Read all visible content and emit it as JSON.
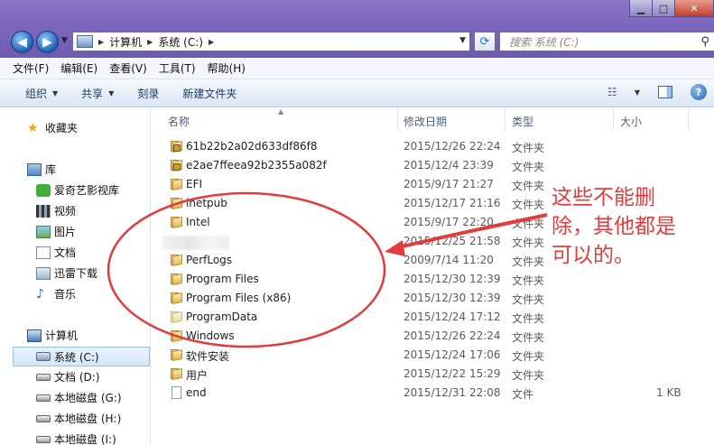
{
  "window": {
    "controls": {
      "minimize": "▁",
      "maximize": "□",
      "close": "✕"
    }
  },
  "nav": {
    "back": "◀",
    "forward": "▶"
  },
  "address": {
    "crumbs": [
      "计算机",
      "系统 (C:)"
    ],
    "search_placeholder": "搜索 系统 (C:)"
  },
  "menubar": [
    "文件(F)",
    "编辑(E)",
    "查看(V)",
    "工具(T)",
    "帮助(H)"
  ],
  "toolbar": {
    "organize": "组织",
    "share": "共享",
    "burn": "刻录",
    "new_folder": "新建文件夹"
  },
  "sidebar": {
    "favorites": "收藏夹",
    "libraries": "库",
    "library_items": [
      "爱奇艺影视库",
      "视频",
      "图片",
      "文档",
      "迅雷下载",
      "音乐"
    ],
    "computer": "计算机",
    "drives": [
      "系统 (C:)",
      "文档 (D:)",
      "本地磁盘 (G:)",
      "本地磁盘 (H:)",
      "本地磁盘 (I:)"
    ]
  },
  "columns": {
    "name": "名称",
    "date": "修改日期",
    "type": "类型",
    "size": "大小"
  },
  "files": [
    {
      "name": "61b22b2a02d633df86f8",
      "date": "2015/12/26 22:24",
      "type": "文件夹",
      "size": "",
      "icon": "folder-lock"
    },
    {
      "name": "e2ae7ffeea92b2355a082f",
      "date": "2015/12/4 23:39",
      "type": "文件夹",
      "size": "",
      "icon": "folder-lock"
    },
    {
      "name": "EFI",
      "date": "2015/9/17 21:27",
      "type": "文件夹",
      "size": "",
      "icon": "folder"
    },
    {
      "name": "inetpub",
      "date": "2015/12/17 21:16",
      "type": "文件夹",
      "size": "",
      "icon": "folder"
    },
    {
      "name": "Intel",
      "date": "2015/9/17 22:20",
      "type": "文件夹",
      "size": "",
      "icon": "folder"
    },
    {
      "name": "",
      "date": "2015/12/25 21:58",
      "type": "文件夹",
      "size": "",
      "icon": "blurred"
    },
    {
      "name": "PerfLogs",
      "date": "2009/7/14 11:20",
      "type": "文件夹",
      "size": "",
      "icon": "folder"
    },
    {
      "name": "Program Files",
      "date": "2015/12/30 12:39",
      "type": "文件夹",
      "size": "",
      "icon": "folder"
    },
    {
      "name": "Program Files (x86)",
      "date": "2015/12/30 12:39",
      "type": "文件夹",
      "size": "",
      "icon": "folder"
    },
    {
      "name": "ProgramData",
      "date": "2015/12/24 17:12",
      "type": "文件夹",
      "size": "",
      "icon": "folder-pale"
    },
    {
      "name": "Windows",
      "date": "2015/12/26 22:24",
      "type": "文件夹",
      "size": "",
      "icon": "folder"
    },
    {
      "name": "软件安装",
      "date": "2015/12/24 17:06",
      "type": "文件夹",
      "size": "",
      "icon": "folder"
    },
    {
      "name": "用户",
      "date": "2015/12/22 15:29",
      "type": "文件夹",
      "size": "",
      "icon": "folder"
    },
    {
      "name": "end",
      "date": "2015/12/31 22:08",
      "type": "文件",
      "size": "1 KB",
      "icon": "file"
    }
  ],
  "annotation": {
    "text": "这些不能删\n除，其他都是\n可以的。",
    "color": "#e03c3c"
  }
}
